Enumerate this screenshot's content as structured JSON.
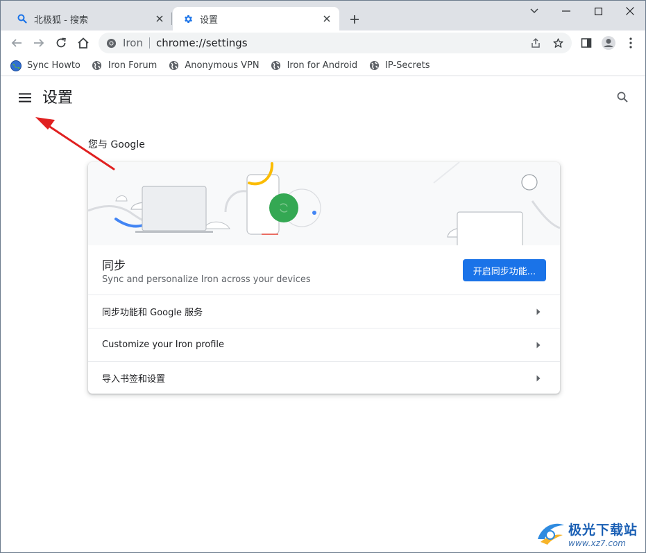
{
  "tabs": [
    {
      "title": "北极狐 - 搜索",
      "icon": "search-icon",
      "active": false
    },
    {
      "title": "设置",
      "icon": "gear-icon",
      "active": true
    }
  ],
  "omnibox": {
    "site_name": "Iron",
    "url": "chrome://settings"
  },
  "bookmarks": [
    {
      "label": "Sync Howto",
      "icon": "globe-color-icon"
    },
    {
      "label": "Iron Forum",
      "icon": "globe-icon"
    },
    {
      "label": "Anonymous VPN",
      "icon": "globe-icon"
    },
    {
      "label": "Iron for Android",
      "icon": "globe-icon"
    },
    {
      "label": "IP-Secrets",
      "icon": "globe-icon"
    }
  ],
  "settings": {
    "title": "设置",
    "section": "您与 Google",
    "sync": {
      "title": "同步",
      "subtitle": "Sync and personalize Iron across your devices",
      "button": "开启同步功能..."
    },
    "rows": [
      {
        "label": "同步功能和 Google 服务"
      },
      {
        "label": "Customize your Iron profile"
      },
      {
        "label": "导入书签和设置"
      }
    ]
  },
  "watermark": {
    "text": "极光下载站",
    "url": "www.xz7.com"
  },
  "colors": {
    "accent": "#1a73e8",
    "annotation": "#e02020",
    "tabstrip": "#dee1e6"
  }
}
